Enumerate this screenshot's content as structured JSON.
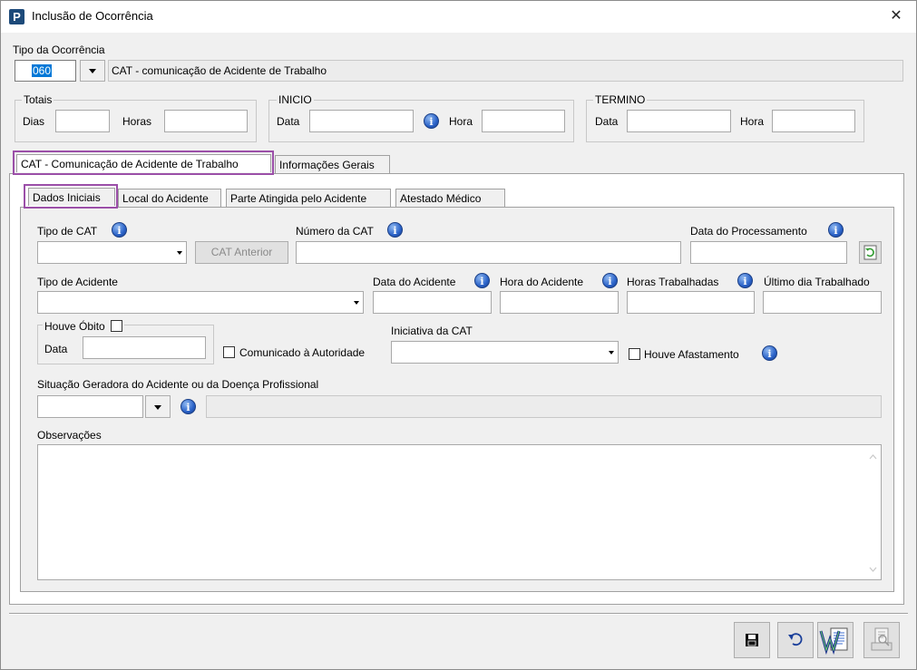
{
  "window": {
    "title": "Inclusão de Ocorrência",
    "app_icon_letter": "P",
    "close_glyph": "✕"
  },
  "tipo_ocorrencia": {
    "label": "Tipo da Ocorrência",
    "code": "060",
    "description": "CAT - comunicação de Acidente de Trabalho"
  },
  "totais": {
    "legend": "Totais",
    "dias_label": "Dias",
    "dias_value": "",
    "horas_label": "Horas",
    "horas_value": ""
  },
  "inicio": {
    "legend": "INICIO",
    "data_label": "Data",
    "data_value": "",
    "hora_label": "Hora",
    "hora_value": ""
  },
  "termino": {
    "legend": "TERMINO",
    "data_label": "Data",
    "data_value": "",
    "hora_label": "Hora",
    "hora_value": ""
  },
  "outer_tabs": [
    {
      "label": "CAT - Comunicação de Acidente de Trabalho",
      "active": true
    },
    {
      "label": "Informações Gerais",
      "active": false
    }
  ],
  "inner_tabs": [
    {
      "label": "Dados Iniciais",
      "active": true
    },
    {
      "label": "Local do Acidente",
      "active": false
    },
    {
      "label": "Parte Atingida pelo Acidente",
      "active": false
    },
    {
      "label": "Atestado Médico",
      "active": false
    }
  ],
  "dados_iniciais": {
    "tipo_cat_label": "Tipo de CAT",
    "tipo_cat_value": "",
    "cat_anterior_button": "CAT Anterior",
    "numero_cat_label": "Número da CAT",
    "numero_cat_value": "",
    "data_processamento_label": "Data do Processamento",
    "data_processamento_value": "",
    "tipo_acidente_label": "Tipo de Acidente",
    "tipo_acidente_value": "",
    "data_acidente_label": "Data do Acidente",
    "hora_acidente_label": "Hora do Acidente",
    "horas_trabalhadas_label": "Horas Trabalhadas",
    "ultimo_dia_label": "Último dia Trabalhado",
    "houve_obito_legend": "Houve Óbito",
    "obito_data_label": "Data",
    "comunicado_autoridade_label": "Comunicado à Autoridade",
    "iniciativa_cat_label": "Iniciativa da CAT",
    "houve_afastamento_label": "Houve Afastamento",
    "situacao_geradora_label": "Situação Geradora do Acidente ou da Doença Profissional",
    "observacoes_label": "Observações",
    "observacoes_value": ""
  },
  "icons": {
    "info": "i",
    "refresh": "refresh-icon",
    "save": "save-icon",
    "undo": "undo-icon",
    "word": "word-document-icon",
    "print": "print-preview-icon"
  },
  "colors": {
    "highlight": "#9b4fa8",
    "info_blue": "#2a62c8",
    "selection": "#0078d7"
  }
}
